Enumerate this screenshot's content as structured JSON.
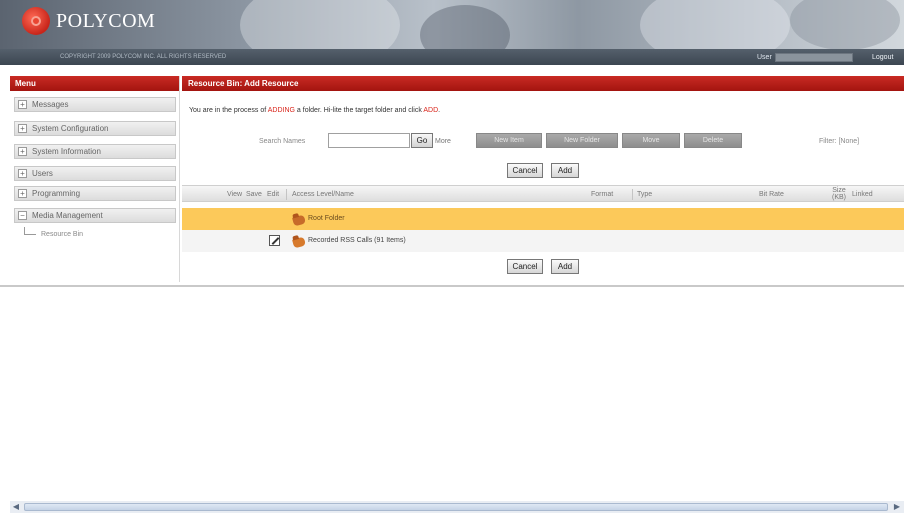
{
  "header": {
    "logo_text": "POLYCOM",
    "copyright": "COPYRIGHT 2009 POLYCOM INC. ALL RIGHTS RESERVED",
    "user_label": "User",
    "user_value": "",
    "logout_label": "Logout"
  },
  "menu": {
    "title": "Menu",
    "items": [
      {
        "sign": "+",
        "label": "Messages"
      },
      {
        "sign": "+",
        "label": "System Configuration"
      },
      {
        "sign": "+",
        "label": "System Information"
      },
      {
        "sign": "+",
        "label": "Users"
      },
      {
        "sign": "+",
        "label": "Programming"
      },
      {
        "sign": "−",
        "label": "Media Management"
      }
    ],
    "sub_item": "Resource Bin"
  },
  "main": {
    "title": "Resource Bin: Add Resource",
    "instruction": {
      "pre": "You are in the process of ",
      "action": "ADDING",
      "mid": " a folder. Hi-lite the target folder and click ",
      "target": "ADD",
      "post": "."
    },
    "search": {
      "label": "Search Names",
      "value": "",
      "go": "Go",
      "more": "More"
    },
    "toolbar": {
      "new_item": "New Item",
      "new_folder": "New Folder",
      "move": "Move",
      "delete": "Delete"
    },
    "filter": "Filter: [None]",
    "cancel": "Cancel",
    "add": "Add",
    "columns": {
      "view": "View",
      "save": "Save",
      "edit": "Edit",
      "access": "Access Level/Name",
      "format": "Format",
      "type": "Type",
      "bitrate": "Bit Rate",
      "size": "Size (KB)",
      "linked": "Linked"
    },
    "rows": [
      {
        "name": "Root Folder"
      },
      {
        "name": "Recorded RSS Calls (91 Items)"
      }
    ]
  },
  "scrollbar": {
    "left_arrow": "◀",
    "right_arrow": "▶"
  },
  "colors": {
    "header_red": "#b81e18",
    "selected_row": "#fcc95a",
    "accent_red_text": "#d9261c"
  }
}
